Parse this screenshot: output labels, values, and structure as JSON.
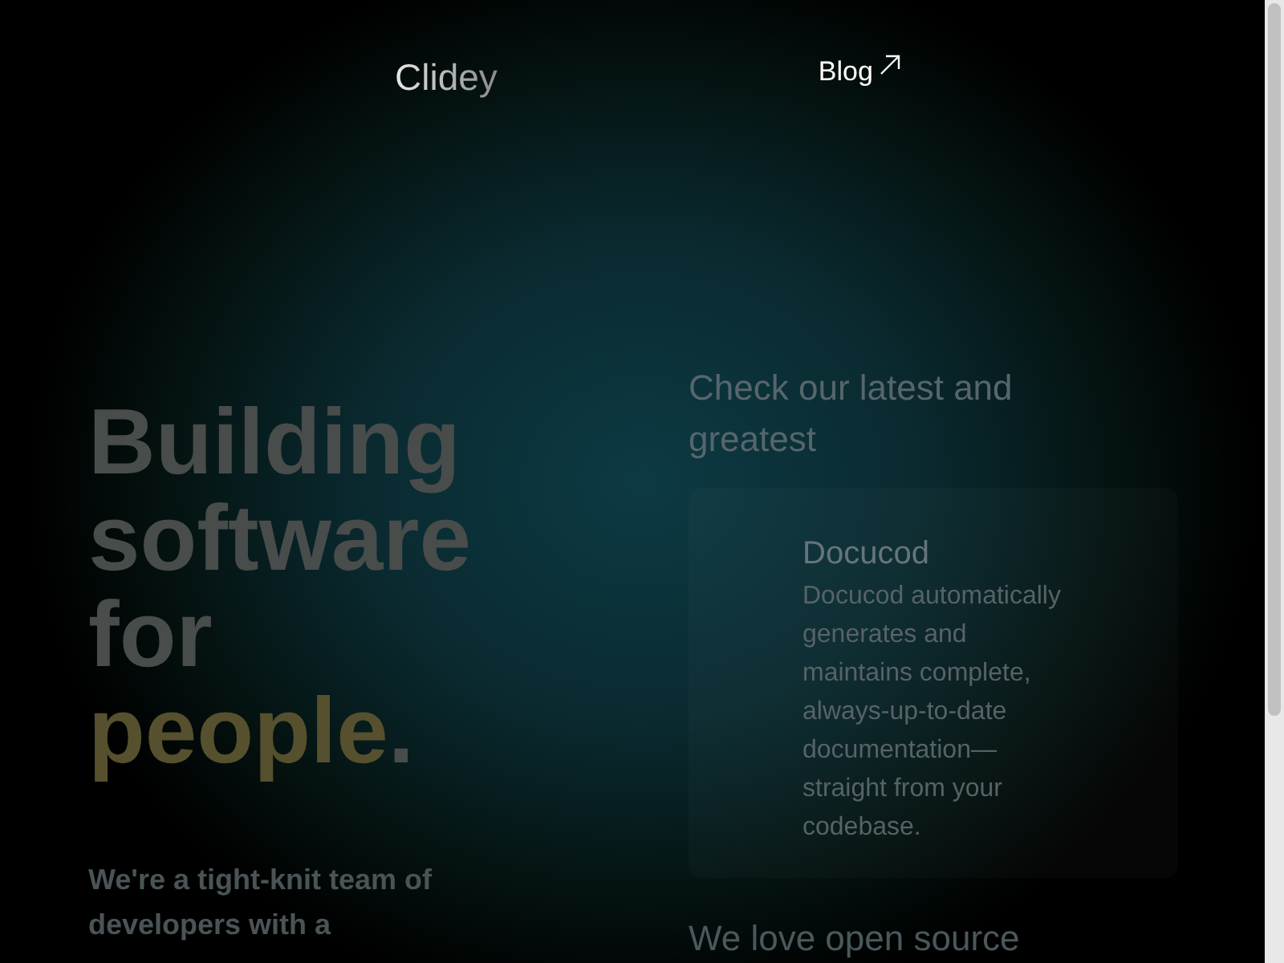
{
  "header": {
    "logo": "Clidey",
    "nav": [
      {
        "label": "Blog",
        "external": true
      }
    ]
  },
  "hero": {
    "headline": "Building software for",
    "highlight": "people",
    "end": ".",
    "intro": "We're a tight-knit team of developers with a"
  },
  "products": {
    "heading": "Check our latest and greatest",
    "items": [
      {
        "name": "Docucod",
        "description": "Docucod automatically generates and maintains complete, always-up-to-date documentation—straight from your codebase."
      }
    ]
  },
  "open_source": {
    "heading": "We love open source"
  }
}
